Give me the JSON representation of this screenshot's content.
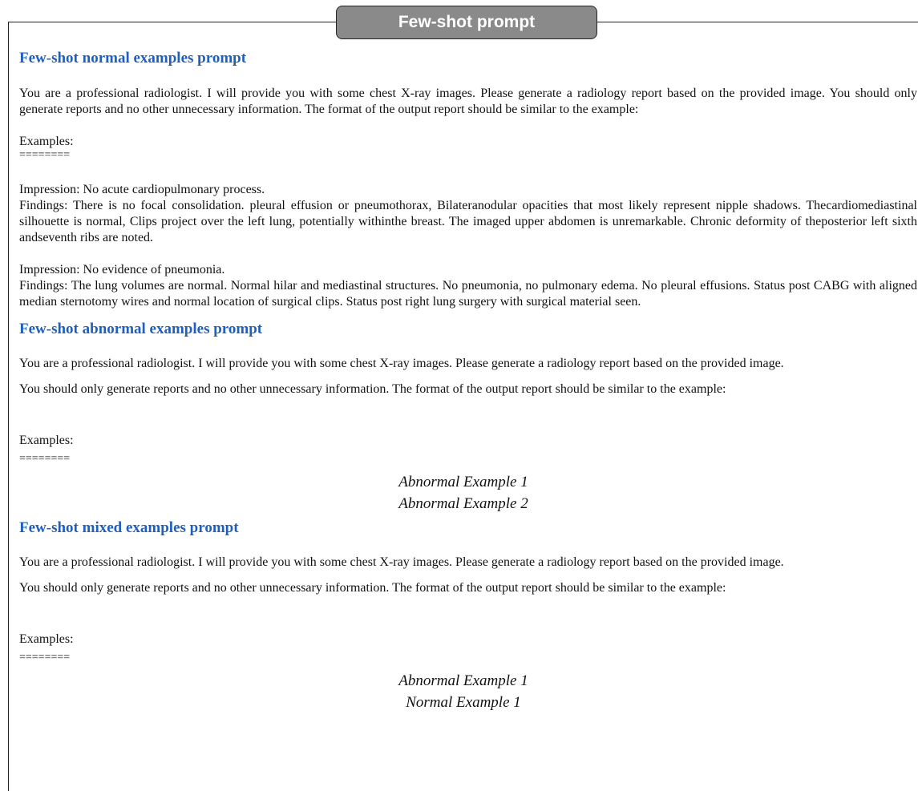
{
  "title": "Few-shot prompt",
  "sections": {
    "normal": {
      "heading": "Few-shot normal examples prompt",
      "intro": "You are a professional radiologist. I will provide you with some chest X-ray images. Please generate a radiology report based on the provided image. You should only generate reports and no other unnecessary information. The format of the output report should be similar to the example:",
      "examples_label": "Examples:",
      "separator": "========",
      "example1_impression": "Impression: No acute cardiopulmonary process.",
      "example1_findings": "Findings: There is no focal consolidation. pleural effusion or pneumothorax, Bilateranodular opacities that most likely represent nipple shadows. Thecardiomediastinal silhouette is normal, Clips project over the left lung, potentially withinthe breast. The imaged upper abdomen is unremarkable. Chronic deformity of theposterior left sixth andseventh ribs are noted.",
      "example2_impression": "Impression: No evidence of pneumonia.",
      "example2_findings": "Findings: The lung volumes are normal. Normal hilar and mediastinal structures. No pneumonia, no pulmonary edema. No pleural effusions. Status post CABG with aligned median sternotomy wires and normal location of surgical clips. Status post right lung surgery with surgical material seen."
    },
    "abnormal": {
      "heading": "Few-shot abnormal examples prompt",
      "intro_line1": "You are a professional radiologist. I will provide you with some chest X-ray images. Please generate a radiology report based on the provided image.",
      "intro_line2": "You should only generate reports and no other unnecessary information. The format of the output report should be similar to the example:",
      "examples_label": "Examples:",
      "separator": "========",
      "example1": "Abnormal Example 1",
      "example2": "Abnormal Example 2"
    },
    "mixed": {
      "heading": "Few-shot mixed examples prompt",
      "intro_line1": "You are a professional radiologist. I will provide you with some chest X-ray images. Please generate a radiology report based on the provided image.",
      "intro_line2": "You should only generate reports and no other unnecessary information. The format of the output report should be similar to the example:",
      "examples_label": "Examples:",
      "separator": "========",
      "example1": "Abnormal Example 1",
      "example2": "Normal Example 1"
    }
  }
}
